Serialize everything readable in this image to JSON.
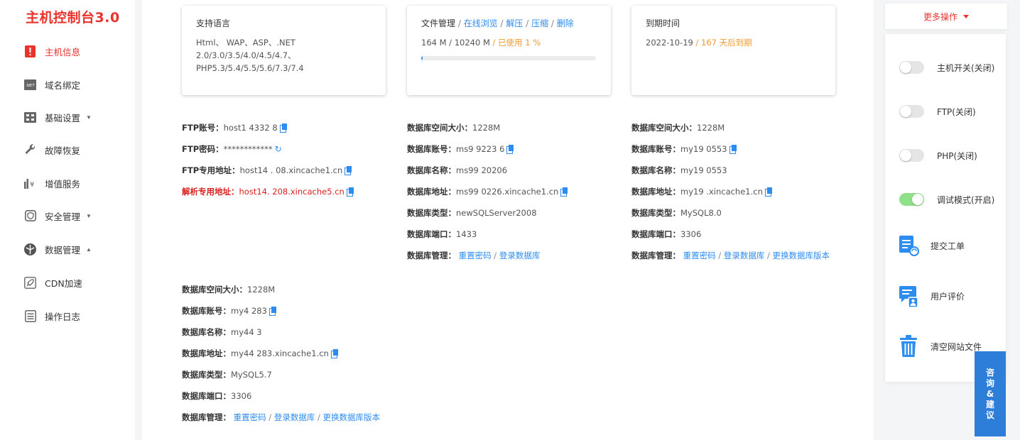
{
  "brand": "主机控制台3.0",
  "sidebar": {
    "items": [
      {
        "label": "主机信息",
        "icon": "alert-icon"
      },
      {
        "label": "域名绑定",
        "icon": "net-icon"
      },
      {
        "label": "基础设置",
        "icon": "settings-grid-icon"
      },
      {
        "label": "故障恢复",
        "icon": "wrench-icon"
      },
      {
        "label": "增值服务",
        "icon": "yen-chart-icon"
      },
      {
        "label": "安全管理",
        "icon": "shield-icon"
      },
      {
        "label": "数据管理",
        "icon": "database-icon"
      },
      {
        "label": "CDN加速",
        "icon": "rocket-icon"
      },
      {
        "label": "操作日志",
        "icon": "log-icon"
      }
    ]
  },
  "cards": {
    "language": {
      "title": "支持语言",
      "line1": "Html、 WAP、ASP、.NET",
      "line2": "2.0/3.0/3.5/4.0/4.5/4.7、",
      "line3": "PHP5.3/5.4/5.5/5.6/7.3/7.4"
    },
    "files": {
      "title": "文件管理",
      "browse": "在线浏览",
      "unzip": "解压",
      "zip": "压缩",
      "delete": "删除",
      "usage": "164 M / 10240 M",
      "used": "已使用 1 %",
      "progress_percent": 1
    },
    "expire": {
      "title": "到期时间",
      "date": "2022-10-19",
      "remaining": "167 天后到期"
    }
  },
  "ftp": {
    "account_label": "FTP账号：",
    "account": "host1 4332 8",
    "password_label": "FTP密码：",
    "password": "************",
    "address_label": "FTP专用地址：",
    "address": "host14 . 08.xincache1.cn",
    "resolve_label": "解析专用地址：",
    "resolve": "host14. 208.xincache5.cn"
  },
  "db_mssql": {
    "size_label": "数据库空间大小：",
    "size": "1228M",
    "account_label": "数据库账号：",
    "account": "ms9 9223 6",
    "name_label": "数据库名称：",
    "name": "ms99 20206",
    "addr_label": "数据库地址：",
    "addr": "ms99 0226.xincache1.cn",
    "type_label": "数据库类型：",
    "type": "newSQLServer2008",
    "port_label": "数据库端口：",
    "port": "1433",
    "manage_label": "数据库管理：",
    "reset": "重置密码",
    "login": "登录数据库"
  },
  "db_mysql8": {
    "size_label": "数据库空间大小：",
    "size": "1228M",
    "account_label": "数据库账号：",
    "account": "my19 0553",
    "name_label": "数据库名称：",
    "name": "my19 0553",
    "addr_label": "数据库地址：",
    "addr": "my19 .xincache1.cn",
    "type_label": "数据库类型：",
    "type": "MySQL8.0",
    "port_label": "数据库端口：",
    "port": "3306",
    "manage_label": "数据库管理：",
    "reset": "重置密码",
    "login": "登录数据库",
    "change": "更换数据库版本"
  },
  "db_mysql5": {
    "size_label": "数据库空间大小：",
    "size": "1228M",
    "account_label": "数据库账号：",
    "account": "my4 283",
    "name_label": "数据库名称：",
    "name": "my44 3",
    "addr_label": "数据库地址：",
    "addr": "my44 283.xincache1.cn",
    "type_label": "数据库类型：",
    "type": "MySQL5.7",
    "port_label": "数据库端口：",
    "port": "3306",
    "manage_label": "数据库管理：",
    "reset": "重置密码",
    "login": "登录数据库",
    "change": "更换数据库版本"
  },
  "right": {
    "more": "更多操作",
    "toggles": [
      {
        "label": "主机开关(关闭)",
        "on": false
      },
      {
        "label": "FTP(关闭)",
        "on": false
      },
      {
        "label": "PHP(关闭)",
        "on": false
      },
      {
        "label": "调试模式(开启)",
        "on": true
      }
    ],
    "actions": [
      {
        "label": "提交工单",
        "icon": "ticket-icon"
      },
      {
        "label": "用户评价",
        "icon": "review-icon"
      },
      {
        "label": "清空网站文件",
        "icon": "trash-icon"
      }
    ],
    "consult": "咨询&建议",
    "colors": {
      "brand_red": "#e8342d",
      "link_blue": "#2d8cf0",
      "toggle_on": "#8fe089",
      "consult_blue": "#2d7ed9"
    }
  }
}
